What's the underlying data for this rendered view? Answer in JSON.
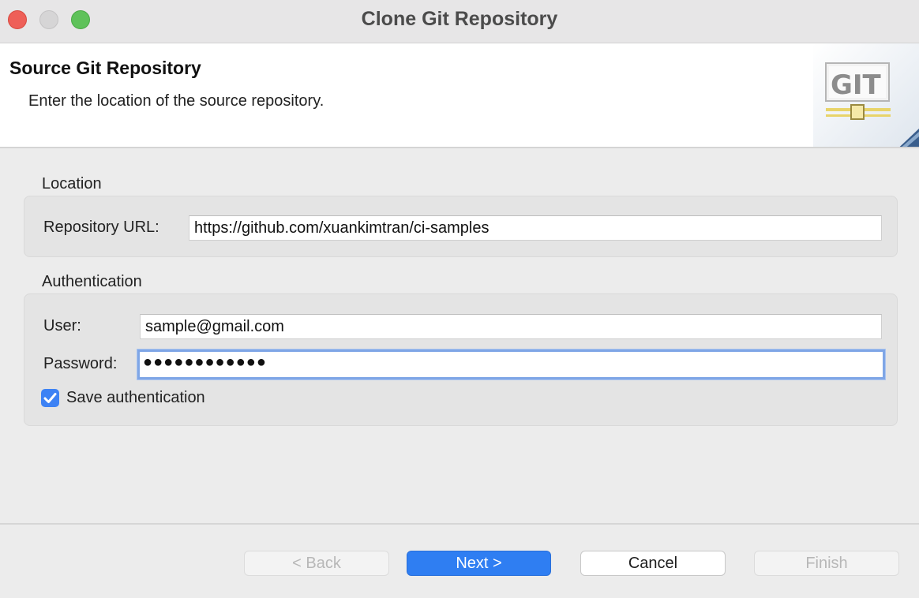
{
  "window": {
    "title": "Clone Git Repository",
    "controls": [
      "close",
      "minimize",
      "maximize"
    ]
  },
  "banner": {
    "title": "Source Git Repository",
    "description": "Enter the location of the source repository.",
    "logo_text": "GIT"
  },
  "location": {
    "group_label": "Location",
    "repository_url_label": "Repository URL:",
    "repository_url_value": "https://github.com/xuankimtran/ci-samples"
  },
  "authentication": {
    "group_label": "Authentication",
    "user_label": "User:",
    "user_value": "sample@gmail.com",
    "password_label": "Password:",
    "password_value": "●●●●●●●●●●●●",
    "save_label": "Save authentication",
    "save_checked": true
  },
  "buttons": {
    "back": "< Back",
    "next": "Next >",
    "cancel": "Cancel",
    "finish": "Finish"
  },
  "colors": {
    "accent": "#2f7ef2",
    "close": "#ee5f58",
    "maximize": "#5fc25a"
  }
}
